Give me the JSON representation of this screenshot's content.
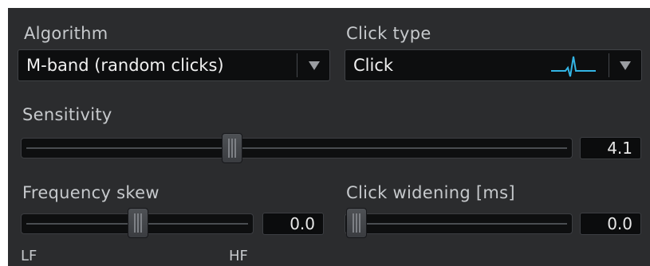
{
  "algorithm": {
    "label": "Algorithm",
    "selected": "M-band (random clicks)",
    "arrow_icon": "triangle-down"
  },
  "click_type": {
    "label": "Click type",
    "selected": "Click",
    "preview_icon": "click-waveform",
    "preview_color": "#33b5e5",
    "arrow_icon": "triangle-down"
  },
  "sensitivity": {
    "label": "Sensitivity",
    "value": "4.1"
  },
  "frequency_skew": {
    "label": "Frequency skew",
    "value": "0.0",
    "min_label": "LF",
    "max_label": "HF"
  },
  "click_widening": {
    "label": "Click widening [ms]",
    "value": "0.0"
  }
}
